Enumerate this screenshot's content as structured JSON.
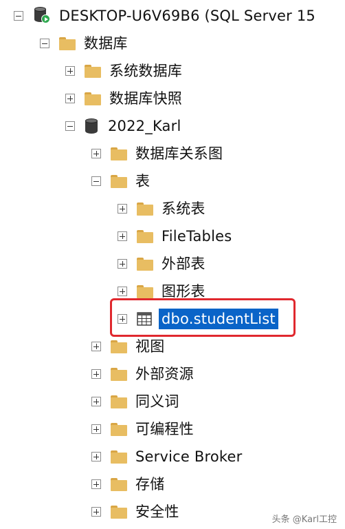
{
  "tree": {
    "server": {
      "label": "DESKTOP-U6V69B6 (SQL Server 15"
    },
    "databases": {
      "label": "数据库"
    },
    "system_databases": {
      "label": "系统数据库"
    },
    "db_snapshots": {
      "label": "数据库快照"
    },
    "db_2022_karl": {
      "label": "2022_Karl"
    },
    "db_diagrams": {
      "label": "数据库关系图"
    },
    "tables": {
      "label": "表"
    },
    "system_tables": {
      "label": "系统表"
    },
    "filetables": {
      "label": "FileTables"
    },
    "external_tables": {
      "label": "外部表"
    },
    "graph_tables": {
      "label": "图形表"
    },
    "student_list": {
      "label": "dbo.studentList",
      "selected": true
    },
    "views": {
      "label": "视图"
    },
    "external_resources": {
      "label": "外部资源"
    },
    "synonyms": {
      "label": "同义词"
    },
    "programmability": {
      "label": "可编程性"
    },
    "service_broker": {
      "label": "Service Broker"
    },
    "storage": {
      "label": "存储"
    },
    "security": {
      "label": "安全性"
    }
  },
  "watermark": {
    "text": "头条 @Karl工控"
  },
  "colors": {
    "selection": "#0a64c8",
    "highlight_border": "#e0282e",
    "folder": "#e8bd62",
    "running": "#2fa84f"
  }
}
